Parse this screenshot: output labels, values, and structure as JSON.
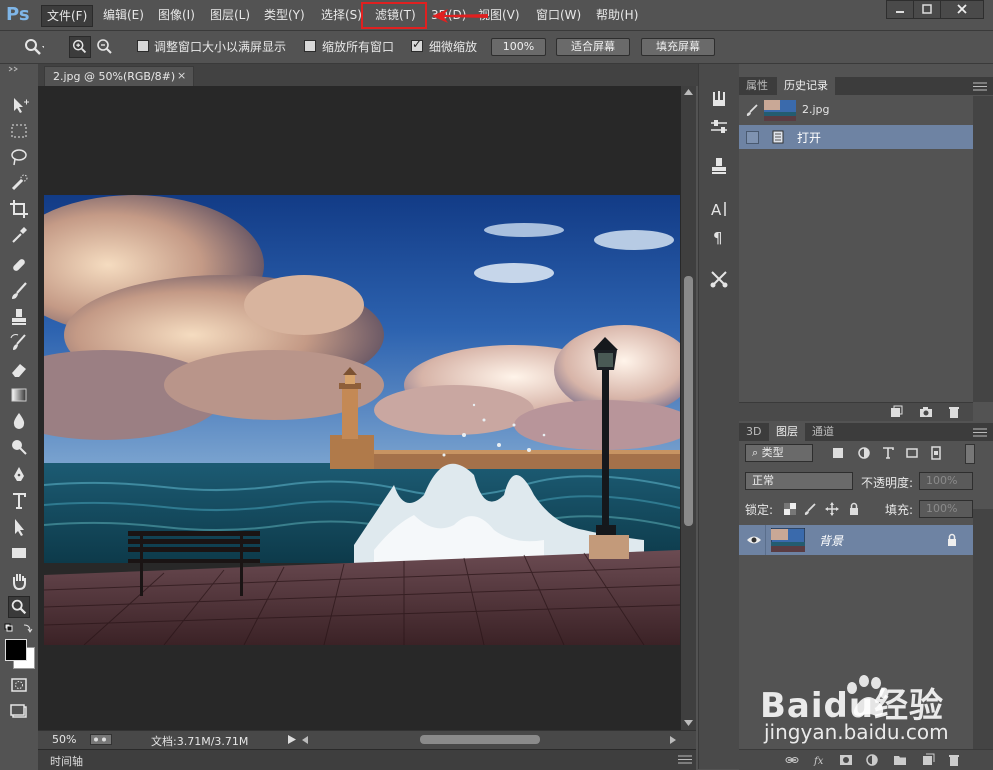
{
  "app": {
    "logo": "Ps"
  },
  "menubar": {
    "items": [
      {
        "label": "文件(F)"
      },
      {
        "label": "编辑(E)"
      },
      {
        "label": "图像(I)"
      },
      {
        "label": "图层(L)"
      },
      {
        "label": "类型(Y)"
      },
      {
        "label": "选择(S)"
      },
      {
        "label": "滤镜(T)"
      },
      {
        "label": "3D(D)"
      },
      {
        "label": "视图(V)"
      },
      {
        "label": "窗口(W)"
      },
      {
        "label": "帮助(H)"
      }
    ],
    "highlight_color": "#e02020"
  },
  "options": {
    "resize_windows": "调整窗口大小以满屏显示",
    "zoom_all": "缩放所有窗口",
    "scrubby_zoom": "细微缩放",
    "btn_100": "100%",
    "btn_fit": "适合屏幕",
    "btn_fill": "填充屏幕"
  },
  "document": {
    "tab_title": "2.jpg @ 50%(RGB/8#)",
    "tab_close": "×",
    "zoom": "50%",
    "doc_size": "文档:3.71M/3.71M"
  },
  "timeline": {
    "label": "时间轴"
  },
  "history_panel": {
    "tabs": [
      "属性",
      "历史记录"
    ],
    "snapshot_name": "2.jpg",
    "steps": [
      "打开"
    ]
  },
  "layers_panel": {
    "tabs": [
      "3D",
      "图层",
      "通道"
    ],
    "filter_kind": "类型",
    "blend_mode": "正常",
    "opacity_label": "不透明度:",
    "opacity_value": "100%",
    "lock_label": "锁定:",
    "fill_label": "填充:",
    "fill_value": "100%",
    "layers": [
      {
        "name": "背景"
      }
    ]
  },
  "watermark": {
    "brand": "Baidu经验",
    "url": "jingyan.baidu.com"
  }
}
